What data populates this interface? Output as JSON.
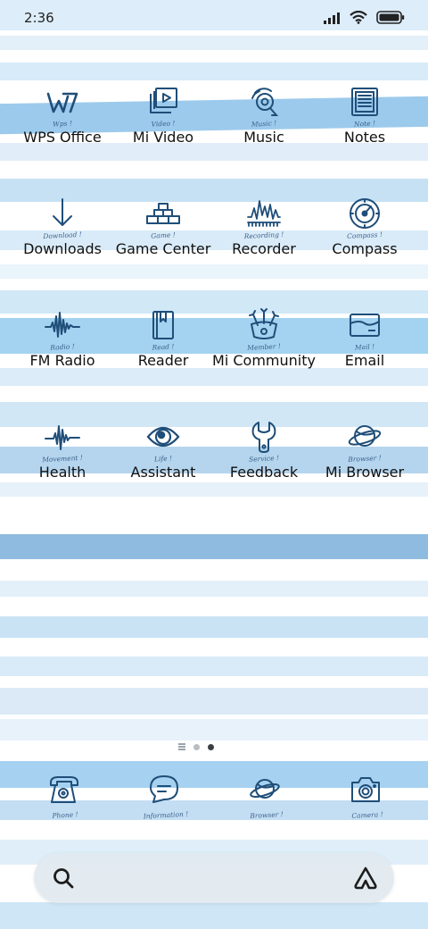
{
  "status_bar": {
    "time": "2:36"
  },
  "colors": {
    "icon": "#1f4e79",
    "stripe_light": "#d6e9f7",
    "stripe_mid": "#a9d2ef",
    "stripe_dark": "#8fbbe0"
  },
  "apps": [
    {
      "name": "wps-office",
      "label": "WPS Office",
      "tag": "Wps !",
      "icon": "wps-icon"
    },
    {
      "name": "mi-video",
      "label": "Mi Video",
      "tag": "Video !",
      "icon": "video-icon"
    },
    {
      "name": "music",
      "label": "Music",
      "tag": "Music !",
      "icon": "music-icon"
    },
    {
      "name": "notes",
      "label": "Notes",
      "tag": "Note !",
      "icon": "notes-icon"
    },
    {
      "name": "downloads",
      "label": "Downloads",
      "tag": "Download !",
      "icon": "download-icon"
    },
    {
      "name": "game-center",
      "label": "Game Center",
      "tag": "Game !",
      "icon": "game-icon"
    },
    {
      "name": "recorder",
      "label": "Recorder",
      "tag": "Recording !",
      "icon": "recorder-icon"
    },
    {
      "name": "compass",
      "label": "Compass",
      "tag": "Compass !",
      "icon": "compass-icon"
    },
    {
      "name": "fm-radio",
      "label": "FM Radio",
      "tag": "Radio !",
      "icon": "radio-icon"
    },
    {
      "name": "reader",
      "label": "Reader",
      "tag": "Read !",
      "icon": "book-icon"
    },
    {
      "name": "mi-community",
      "label": "Mi Community",
      "tag": "Member !",
      "icon": "community-icon"
    },
    {
      "name": "email",
      "label": "Email",
      "tag": "Mail !",
      "icon": "mail-icon"
    },
    {
      "name": "health",
      "label": "Health",
      "tag": "Movement !",
      "icon": "heartbeat-icon"
    },
    {
      "name": "assistant",
      "label": "Assistant",
      "tag": "Life !",
      "icon": "eye-icon"
    },
    {
      "name": "feedback",
      "label": "Feedback",
      "tag": "Service !",
      "icon": "wrench-icon"
    },
    {
      "name": "mi-browser",
      "label": "Mi Browser",
      "tag": "Browser !",
      "icon": "planet-icon"
    }
  ],
  "dock": [
    {
      "name": "phone",
      "tag": "Phone !",
      "icon": "phone-icon"
    },
    {
      "name": "messages",
      "tag": "Information !",
      "icon": "message-icon"
    },
    {
      "name": "browser",
      "tag": "Browser !",
      "icon": "planet-icon"
    },
    {
      "name": "camera",
      "tag": "Camera !",
      "icon": "camera-icon"
    }
  ],
  "page_indicator": {
    "pages": 2,
    "current": 2
  }
}
